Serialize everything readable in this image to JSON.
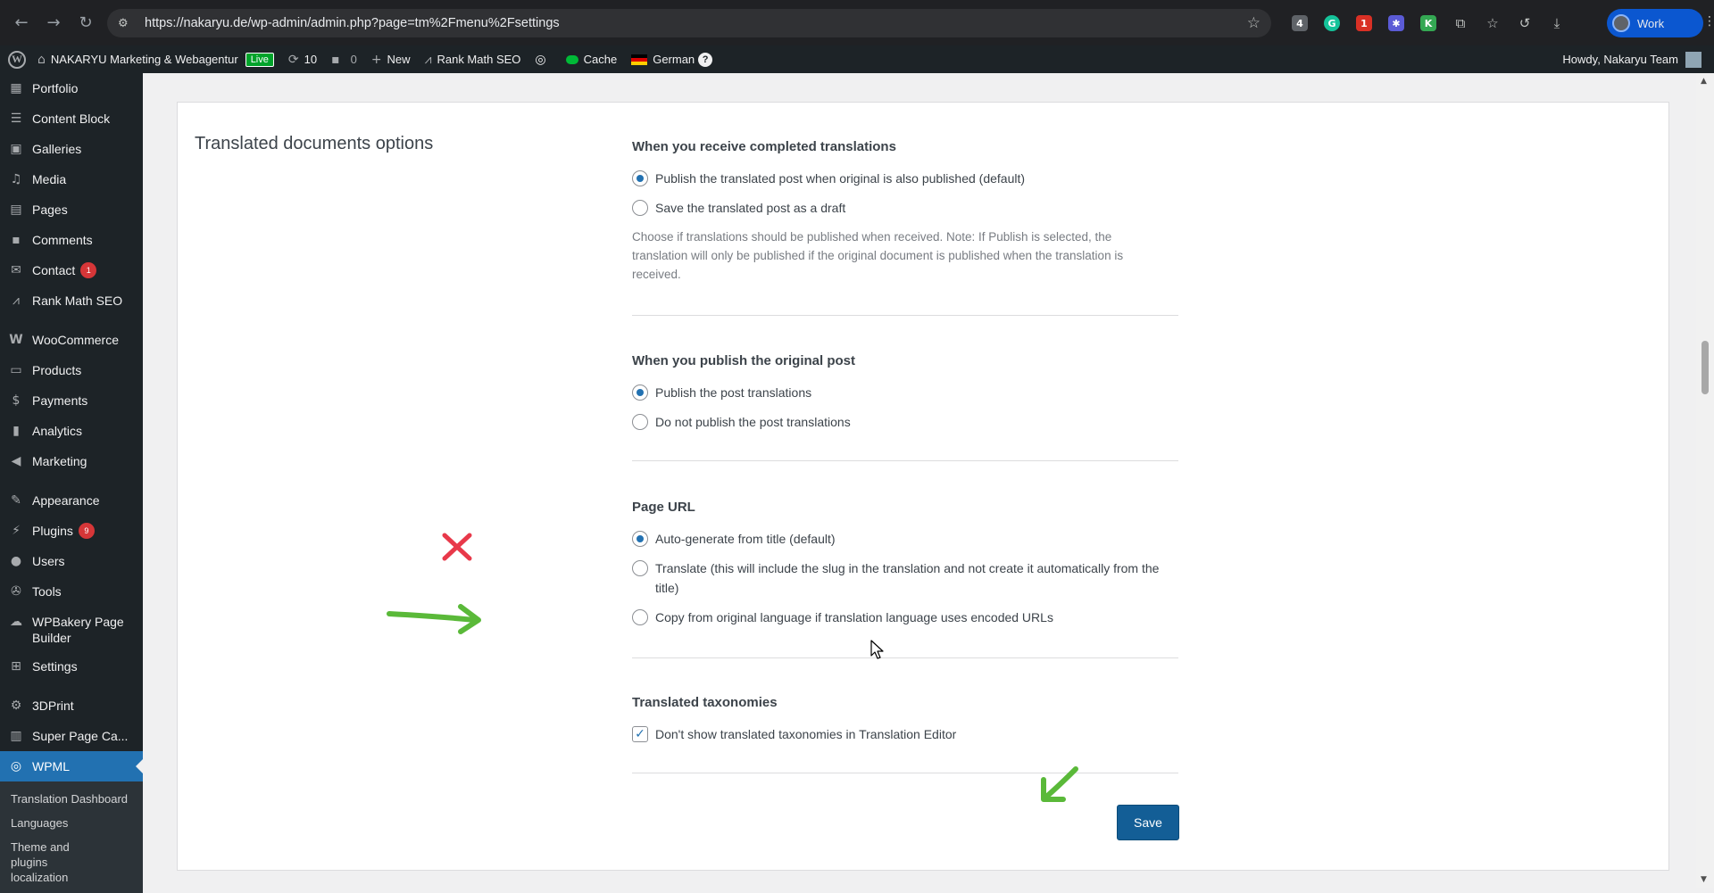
{
  "browser": {
    "url": "https://nakaryu.de/wp-admin/admin.php?page=tm%2Fmenu%2Fsettings",
    "profile_label": "Work"
  },
  "adminbar": {
    "site_name": "NAKARYU Marketing & Webagentur",
    "live_badge": "Live",
    "updates_count": "10",
    "comments_count": "0",
    "new_label": "New",
    "rankmath_label": "Rank Math SEO",
    "cache_label": "Cache",
    "language_label": "German",
    "help_label": "?",
    "howdy": "Howdy, Nakaryu Team"
  },
  "sidebar": {
    "items": [
      {
        "label": "Portfolio",
        "icon": "portfolio-icon"
      },
      {
        "label": "Content Block",
        "icon": "content-block-icon"
      },
      {
        "label": "Galleries",
        "icon": "galleries-icon"
      },
      {
        "label": "Media",
        "icon": "media-icon"
      },
      {
        "label": "Pages",
        "icon": "pages-icon"
      },
      {
        "label": "Comments",
        "icon": "comments-icon"
      },
      {
        "label": "Contact",
        "icon": "contact-icon",
        "badge": "1"
      },
      {
        "label": "Rank Math SEO",
        "icon": "rankmath-icon"
      },
      {
        "label": "WooCommerce",
        "icon": "woocommerce-icon"
      },
      {
        "label": "Products",
        "icon": "products-icon"
      },
      {
        "label": "Payments",
        "icon": "payments-icon"
      },
      {
        "label": "Analytics",
        "icon": "analytics-icon"
      },
      {
        "label": "Marketing",
        "icon": "marketing-icon"
      },
      {
        "label": "Appearance",
        "icon": "appearance-icon"
      },
      {
        "label": "Plugins",
        "icon": "plugins-icon",
        "badge": "9"
      },
      {
        "label": "Users",
        "icon": "users-icon"
      },
      {
        "label": "Tools",
        "icon": "tools-icon"
      },
      {
        "label": "WPBakery Page Builder",
        "icon": "wpbakery-icon"
      },
      {
        "label": "Settings",
        "icon": "settings-icon"
      },
      {
        "label": "3DPrint",
        "icon": "3dprint-icon"
      },
      {
        "label": "Super Page Ca...",
        "icon": "super-page-cache-icon"
      },
      {
        "label": "WPML",
        "icon": "wpml-icon"
      }
    ],
    "submenu": [
      "Translation Dashboard",
      "Languages",
      "Theme and plugins localization"
    ]
  },
  "main": {
    "section_title": "Translated documents options",
    "completed": {
      "title": "When you receive completed translations",
      "options": [
        "Publish the translated post when original is also published (default)",
        "Save the translated post as a draft"
      ],
      "selected": 0,
      "help": "Choose if translations should be published when received. Note: If Publish is selected, the translation will only be published if the original document is published when the translation is received."
    },
    "publish_original": {
      "title": "When you publish the original post",
      "options": [
        "Publish the post translations",
        "Do not publish the post translations"
      ],
      "selected": 0
    },
    "page_url": {
      "title": "Page URL",
      "options": [
        "Auto-generate from title (default)",
        "Translate (this will include the slug in the translation and not create it automatically from the title)",
        "Copy from original language if translation language uses encoded URLs"
      ],
      "selected": 0
    },
    "taxonomies": {
      "title": "Translated taxonomies",
      "checkbox_label": "Don't show translated taxonomies in Translation Editor",
      "checked": true
    },
    "save_label": "Save"
  },
  "colors": {
    "accent": "#2271b1",
    "annotation_green": "#5ab939",
    "annotation_red": "#e8394a"
  }
}
